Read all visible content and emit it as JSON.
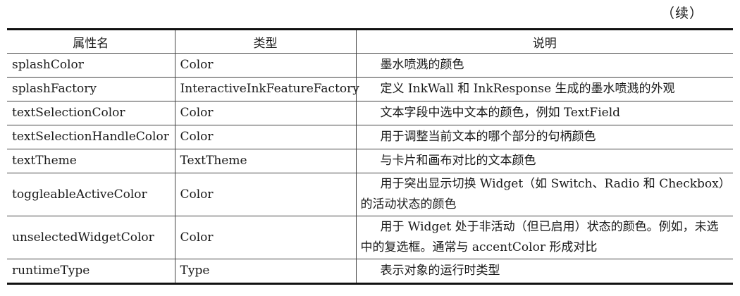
{
  "continued_label": "（续）",
  "table": {
    "headers": [
      "属性名",
      "类型",
      "说明"
    ],
    "rows": [
      {
        "name": "splashColor",
        "type": "Color",
        "description": "墨水喷溅的颜色"
      },
      {
        "name": "splashFactory",
        "type": "InteractiveInkFeatureFactory",
        "description": "定义 InkWall 和 InkResponse 生成的墨水喷溅的外观"
      },
      {
        "name": "textSelectionColor",
        "type": "Color",
        "description": "文本字段中选中文本的颜色，例如 TextField"
      },
      {
        "name": "textSelectionHandleColor",
        "type": "Color",
        "description": "用于调整当前文本的哪个部分的句柄颜色"
      },
      {
        "name": "textTheme",
        "type": "TextTheme",
        "description": "与卡片和画布对比的文本颜色"
      },
      {
        "name": "toggleableActiveColor",
        "type": "Color",
        "description": "用于突出显示切换 Widget（如 Switch、Radio 和 Checkbox）的活动状态的颜色"
      },
      {
        "name": "unselectedWidgetColor",
        "type": "Color",
        "description": "用于 Widget 处于非活动（但已启用）状态的颜色。例如，未选中的复选框。通常与 accentColor 形成对比"
      },
      {
        "name": "runtimeType",
        "type": "Type",
        "description": "表示对象的运行时类型"
      }
    ]
  }
}
